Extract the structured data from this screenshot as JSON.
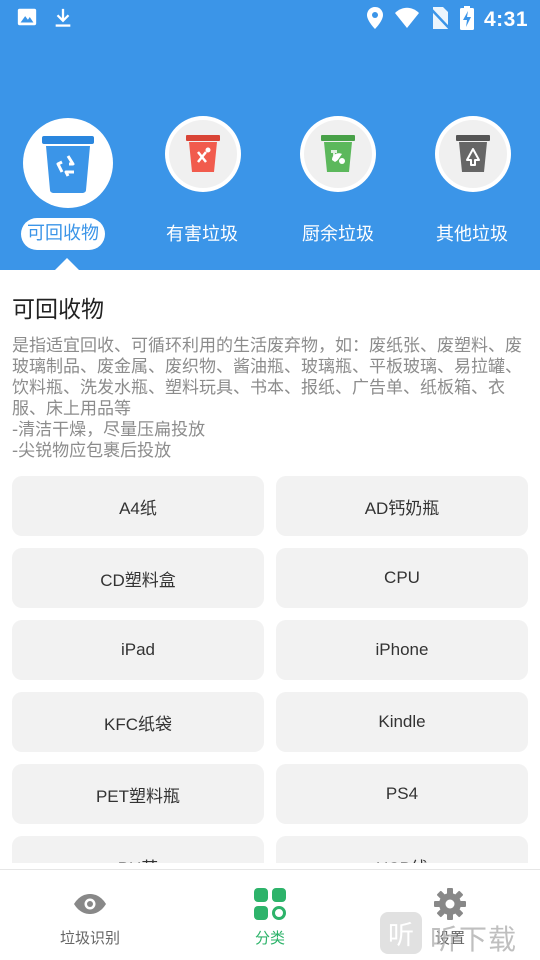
{
  "status_bar": {
    "time": "4:31",
    "left_icons": [
      "image-icon",
      "download-icon"
    ],
    "right_icons": [
      "location-icon",
      "wifi-icon",
      "no-sim-icon",
      "battery-charging-icon"
    ]
  },
  "categories": [
    {
      "label": "可回收物",
      "active": true,
      "color": "#3b95e8",
      "icon": "recycle-bin-icon"
    },
    {
      "label": "有害垃圾",
      "active": false,
      "color": "#f15b4d",
      "icon": "hazardous-bin-icon"
    },
    {
      "label": "厨余垃圾",
      "active": false,
      "color": "#5cb85c",
      "icon": "kitchen-bin-icon"
    },
    {
      "label": "其他垃圾",
      "active": false,
      "color": "#666666",
      "icon": "other-bin-icon"
    }
  ],
  "section": {
    "title": "可回收物",
    "description": "是指适宜回收、可循环利用的生活废弃物，如：废纸张、废塑料、废玻璃制品、废金属、废织物、酱油瓶、玻璃瓶、平板玻璃、易拉罐、饮料瓶、洗发水瓶、塑料玩具、书本、报纸、广告单、纸板箱、衣服、床上用品等\n-清洁干燥，尽量压扁投放\n-尖锐物应包裹后投放"
  },
  "items": [
    "A4纸",
    "AD钙奶瓶",
    "CD塑料盒",
    "CPU",
    "iPad",
    "iPhone",
    "KFC纸袋",
    "Kindle",
    "PET塑料瓶",
    "PS4",
    "PU革",
    "USB线"
  ],
  "nav": {
    "items": [
      {
        "label": "垃圾识别",
        "icon": "eye-icon",
        "active": false
      },
      {
        "label": "分类",
        "icon": "grid-icon",
        "active": true
      },
      {
        "label": "设置",
        "icon": "gear-icon",
        "active": false
      }
    ],
    "active_color": "#2db36a"
  },
  "watermark": {
    "icon_text": "听",
    "text": "听下载"
  }
}
